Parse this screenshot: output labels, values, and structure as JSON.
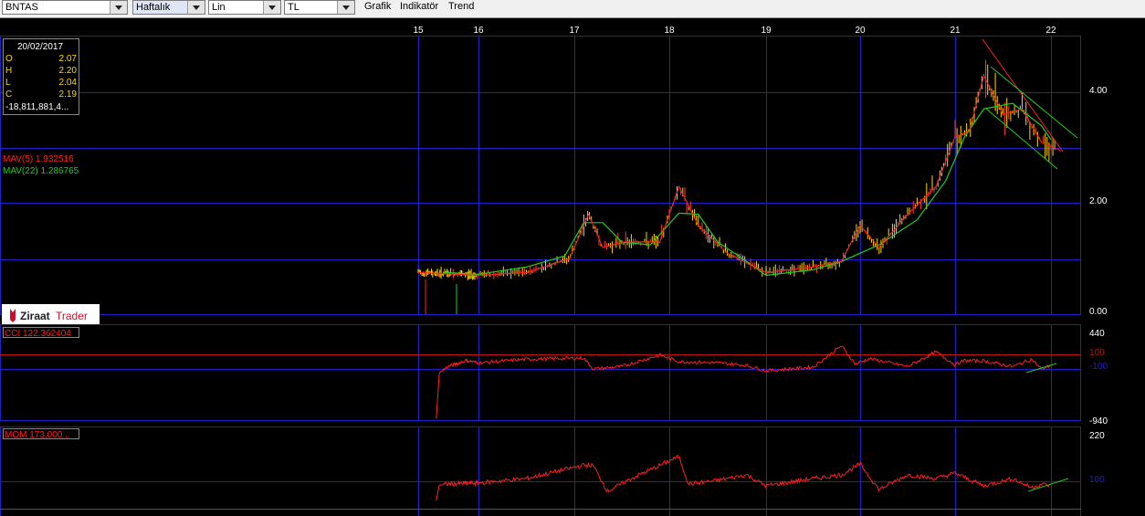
{
  "toolbar": {
    "symbol": "BNTAS",
    "period": "Haftalık",
    "scale": "Lin",
    "currency": "TL",
    "menu": [
      "Grafik",
      "Indikatör",
      "Trend"
    ]
  },
  "brand": {
    "name": "Ziraat",
    "suffix": "Trader"
  },
  "ohlc": {
    "date": "20/02/2017",
    "rows": [
      {
        "label": "O",
        "value": "2.07"
      },
      {
        "label": "H",
        "value": "2.20"
      },
      {
        "label": "L",
        "value": "2.04"
      },
      {
        "label": "C",
        "value": "2.19"
      }
    ],
    "volume": "-18,811,881,4..."
  },
  "indicators": {
    "mav5": "MAV(5) 1.932516",
    "mav22": "MAV(22) 1.286765",
    "cci": "CCI 122.362404",
    "mom": "MOM 173.000..."
  },
  "colors": {
    "price": "#ffd700",
    "price_down": "#ff3b3b",
    "mav5": "#ff2020",
    "mav22": "#22cc22",
    "grid": "#2020c8",
    "indicator": "#ff2020"
  },
  "chart_data": [
    {
      "type": "line",
      "panel": "price",
      "x_ticks": [
        "15",
        "16",
        "17",
        "18",
        "19",
        "20",
        "21",
        "22"
      ],
      "y_ticks": [
        "4.00",
        "2.00",
        "0.00"
      ],
      "ylim": [
        0,
        5
      ],
      "series": [
        {
          "name": "MAV(5)",
          "x": [
            15,
            16,
            16.5,
            16.95,
            17.15,
            17.3,
            17.5,
            17.9,
            18.1,
            18.3,
            18.6,
            19,
            19.5,
            19.8,
            20,
            20.2,
            20.5,
            20.8,
            21,
            21.15,
            21.3,
            21.5,
            21.7,
            21.9,
            22.1
          ],
          "values": [
            0.75,
            0.7,
            0.75,
            1.0,
            1.8,
            1.2,
            1.3,
            1.3,
            2.3,
            1.6,
            1.1,
            0.75,
            0.85,
            0.95,
            1.6,
            1.2,
            1.8,
            2.3,
            3.2,
            3.3,
            4.3,
            3.6,
            3.7,
            3.1,
            2.95
          ]
        },
        {
          "name": "MAV(22)",
          "x": [
            15.45,
            16,
            16.5,
            16.9,
            17.1,
            17.3,
            17.5,
            17.8,
            18.1,
            18.3,
            18.5,
            18.8,
            19,
            19.5,
            19.8,
            20.2,
            20.6,
            20.9,
            21.1,
            21.3,
            21.6,
            21.9,
            22
          ],
          "values": [
            0.75,
            0.72,
            0.85,
            1.05,
            1.65,
            1.65,
            1.3,
            1.25,
            1.82,
            1.8,
            1.3,
            0.95,
            0.7,
            0.8,
            0.95,
            1.25,
            1.7,
            2.4,
            3.2,
            3.7,
            3.8,
            3.4,
            3.15
          ]
        }
      ]
    },
    {
      "type": "line",
      "panel": "cci",
      "y_ticks": [
        "440",
        "100",
        "-100",
        "-940"
      ],
      "ylim": [
        -940,
        440
      ],
      "series": [
        {
          "name": "CCI",
          "x": [
            15.3,
            15.35,
            15.5,
            15.8,
            16,
            16.5,
            17.1,
            17.2,
            17.5,
            17.9,
            18.1,
            18.5,
            18.8,
            19,
            19.5,
            19.8,
            19.95,
            20.1,
            20.5,
            20.8,
            21,
            21.1,
            21.3,
            21.6,
            21.8,
            21.9,
            22
          ],
          "values": [
            -920,
            -160,
            -60,
            40,
            0,
            60,
            80,
            -100,
            -60,
            130,
            20,
            0,
            -40,
            -130,
            -70,
            280,
            -20,
            70,
            -60,
            180,
            -30,
            40,
            30,
            -60,
            60,
            -100,
            -40
          ]
        }
      ]
    },
    {
      "type": "line",
      "panel": "mom",
      "y_ticks": [
        "220",
        "100"
      ],
      "ylim": [
        40,
        220
      ],
      "series": [
        {
          "name": "MOM",
          "x": [
            15.3,
            15.35,
            15.5,
            16,
            16.5,
            17.1,
            17.2,
            17.35,
            17.6,
            18.1,
            18.2,
            18.5,
            18.8,
            19,
            19.5,
            19.8,
            20,
            20.2,
            20.5,
            20.8,
            21,
            21.3,
            21.6,
            21.8,
            21.9,
            22
          ],
          "values": [
            50,
            92,
            95,
            98,
            110,
            147,
            145,
            75,
            110,
            170,
            95,
            105,
            120,
            90,
            110,
            120,
            150,
            80,
            120,
            110,
            125,
            90,
            110,
            85,
            95,
            90
          ]
        }
      ]
    }
  ]
}
